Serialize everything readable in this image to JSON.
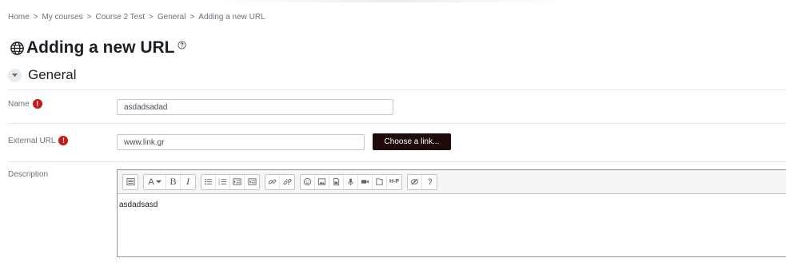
{
  "breadcrumb": [
    "Home",
    "My courses",
    "Course 2 Test",
    "General",
    "Adding a new URL"
  ],
  "page_title": "Adding a new URL",
  "section_title": "General",
  "fields": {
    "name": {
      "label": "Name",
      "value": "asdadsadad"
    },
    "url": {
      "label": "External URL",
      "value": "www.link.gr",
      "button": "Choose a link..."
    },
    "description": {
      "label": "Description",
      "content": "asdadsasd"
    }
  },
  "toolbar": {
    "font_label": "A",
    "bold": "B",
    "italic": "I",
    "h5p": "H-P"
  },
  "colors": {
    "required": "#c91818",
    "button_bg": "#1f0a0a"
  }
}
